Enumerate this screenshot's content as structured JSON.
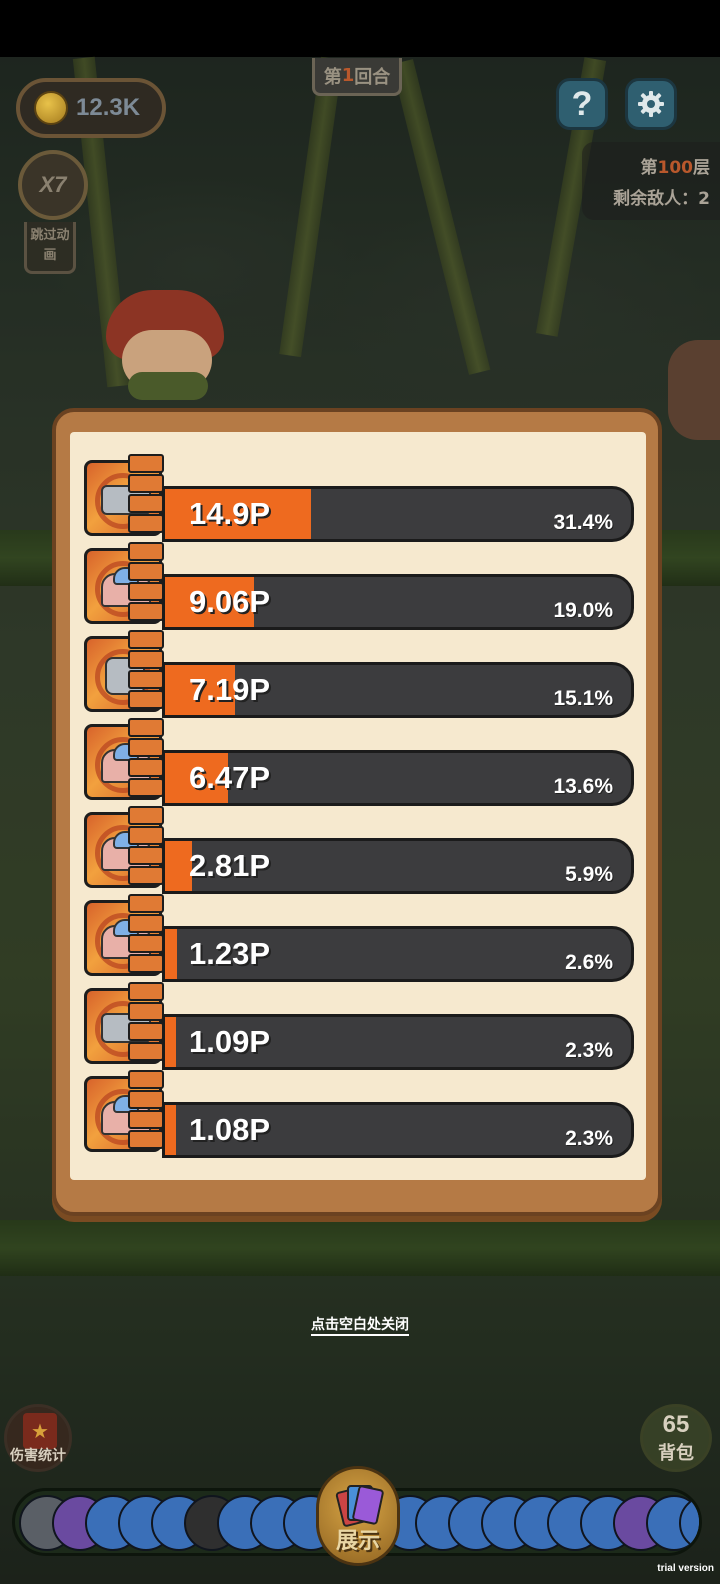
{
  "hud": {
    "coins": "12.3K",
    "round_prefix": "第",
    "round_number": "1",
    "round_suffix": "回合",
    "help_label": "?",
    "floor_prefix": "第",
    "floor_number": "100",
    "floor_suffix": "层",
    "enemies_remaining": "剩余敌人：2",
    "speed": "X7",
    "skip_animation": "跳过动画"
  },
  "damage_rows": [
    {
      "value": "14.9P",
      "percent": "31.4%",
      "fill": 0.314,
      "icon": "rocket-plane-icon",
      "variant": "plane"
    },
    {
      "value": "9.06P",
      "percent": "19.0%",
      "fill": 0.19,
      "icon": "cake-blob-icon",
      "variant": "cake"
    },
    {
      "value": "7.19P",
      "percent": "15.1%",
      "fill": 0.151,
      "icon": "mech-robot-icon",
      "variant": "mech"
    },
    {
      "value": "6.47P",
      "percent": "13.6%",
      "fill": 0.136,
      "icon": "cake-blob-icon",
      "variant": "cake"
    },
    {
      "value": "2.81P",
      "percent": "5.9%",
      "fill": 0.059,
      "icon": "cake-blob-icon",
      "variant": "cake"
    },
    {
      "value": "1.23P",
      "percent": "2.6%",
      "fill": 0.026,
      "icon": "cake-blob-icon",
      "variant": "cake"
    },
    {
      "value": "1.09P",
      "percent": "2.3%",
      "fill": 0.023,
      "icon": "rocket-plane-icon",
      "variant": "plane"
    },
    {
      "value": "1.08P",
      "percent": "2.3%",
      "fill": 0.023,
      "icon": "cake-blob-icon",
      "variant": "cake"
    }
  ],
  "close_hint": "点击空白处关闭",
  "bottom": {
    "damage_stats_label": "伤害统计",
    "backpack_count": "65",
    "backpack_label": "背包",
    "show_label": "展示"
  },
  "watermark": "trial version",
  "colors": {
    "bar_fill": "#ee6a1f",
    "bar_track": "#3c3c3e",
    "panel_frame": "#b57a45",
    "panel_inner": "#f6e9cf"
  }
}
